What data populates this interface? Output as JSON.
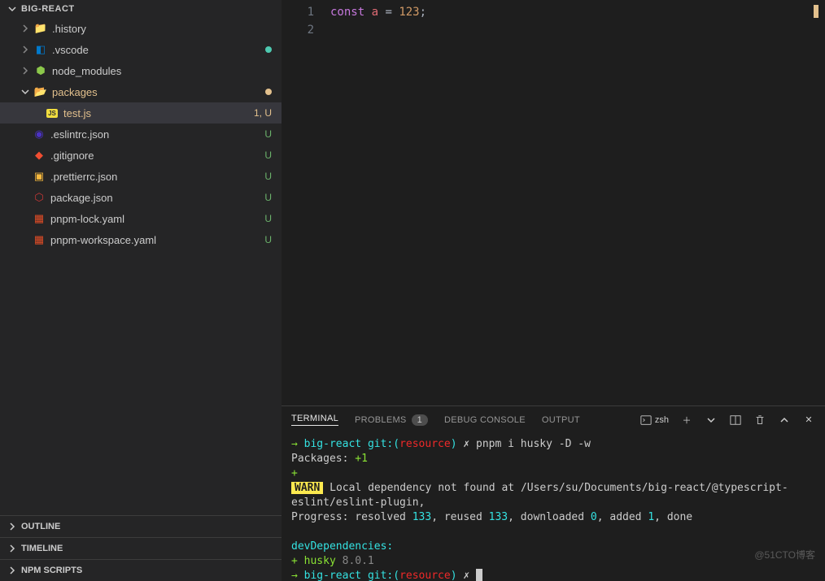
{
  "explorer": {
    "title": "BIG-REACT",
    "tree": [
      {
        "name": ".history",
        "type": "folder",
        "icon": "folder"
      },
      {
        "name": ".vscode",
        "type": "folder",
        "icon": "vscode",
        "status_dot": "green"
      },
      {
        "name": "node_modules",
        "type": "folder",
        "icon": "node"
      },
      {
        "name": "packages",
        "type": "folder",
        "icon": "packages",
        "expanded": true,
        "status_dot": "orange",
        "children": [
          {
            "name": "test.js",
            "type": "file",
            "icon": "js",
            "active": true,
            "status": "1, U"
          }
        ]
      },
      {
        "name": ".eslintrc.json",
        "type": "file",
        "icon": "eslint",
        "status": "U"
      },
      {
        "name": ".gitignore",
        "type": "file",
        "icon": "git",
        "status": "U"
      },
      {
        "name": ".prettierrc.json",
        "type": "file",
        "icon": "prettier",
        "status": "U"
      },
      {
        "name": "package.json",
        "type": "file",
        "icon": "npm",
        "status": "U"
      },
      {
        "name": "pnpm-lock.yaml",
        "type": "file",
        "icon": "yaml",
        "status": "U"
      },
      {
        "name": "pnpm-workspace.yaml",
        "type": "file",
        "icon": "yaml",
        "status": "U"
      }
    ],
    "sections": [
      "OUTLINE",
      "TIMELINE",
      "NPM SCRIPTS"
    ]
  },
  "editor": {
    "lines": [
      {
        "n": "1",
        "tokens": [
          {
            "t": "const",
            "c": "kw"
          },
          {
            "t": " "
          },
          {
            "t": "a",
            "c": "var"
          },
          {
            "t": " = ",
            "c": "op"
          },
          {
            "t": "123",
            "c": "num"
          },
          {
            "t": ";",
            "c": "op"
          }
        ]
      },
      {
        "n": "2",
        "tokens": []
      }
    ]
  },
  "terminal": {
    "tabs": [
      {
        "label": "TERMINAL",
        "active": true
      },
      {
        "label": "PROBLEMS",
        "badge": "1"
      },
      {
        "label": "DEBUG CONSOLE"
      },
      {
        "label": "OUTPUT"
      }
    ],
    "shell": "zsh",
    "output": {
      "l1_arrow": "→",
      "l1_dir": "big-react",
      "l1_git": "git:(",
      "l1_branch": "resource",
      "l1_close": ")",
      "l1_x": "✗",
      "l1_cmd": "pnpm i husky -D -w",
      "l2": "Packages: ",
      "l2_plus": "+1",
      "l3": "+",
      "l4_warn": "WARN",
      "l4_text": " Local dependency not found at /Users/su/Documents/big-react/@typescript-eslint/eslint-plugin,",
      "l5_a": "Progress: resolved ",
      "l5_b": "133",
      "l5_c": ", reused ",
      "l5_d": "133",
      "l5_e": ", downloaded ",
      "l5_f": "0",
      "l5_g": ", added ",
      "l5_h": "1",
      "l5_i": ", done",
      "l6": "devDependencies:",
      "l7_a": "+ husky ",
      "l7_b": "8.0.1",
      "l8_arrow": "→",
      "l8_dir": "big-react",
      "l8_git": "git:(",
      "l8_branch": "resource",
      "l8_close": ")",
      "l8_x": "✗"
    }
  },
  "watermark": "@51CTO博客"
}
